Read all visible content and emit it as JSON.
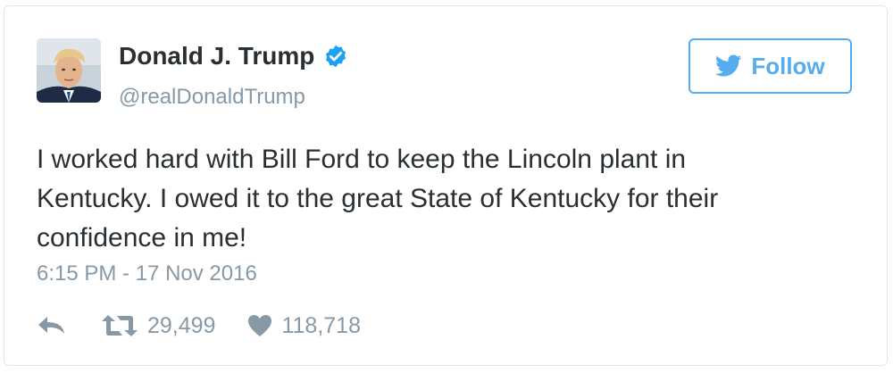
{
  "author": {
    "name": "Donald J. Trump",
    "handle": "@realDonaldTrump",
    "verified": true,
    "avatar_icon": "profile-photo"
  },
  "follow_button": {
    "label": "Follow",
    "icon": "twitter-bird-icon"
  },
  "tweet": {
    "text": "I worked hard with Bill Ford to keep the Lincoln plant in Kentucky. I owed it to the great State of Kentucky for their confidence in me!",
    "timestamp": "6:15 PM - 17 Nov 2016"
  },
  "actions": {
    "reply_icon": "reply-icon",
    "retweet_icon": "retweet-icon",
    "retweet_count": "29,499",
    "like_icon": "heart-icon",
    "like_count": "118,718"
  },
  "colors": {
    "accent": "#55acee",
    "verified": "#1da1f2",
    "text_primary": "#292f33",
    "text_secondary": "#8899a6",
    "border": "#e1e8ed"
  }
}
